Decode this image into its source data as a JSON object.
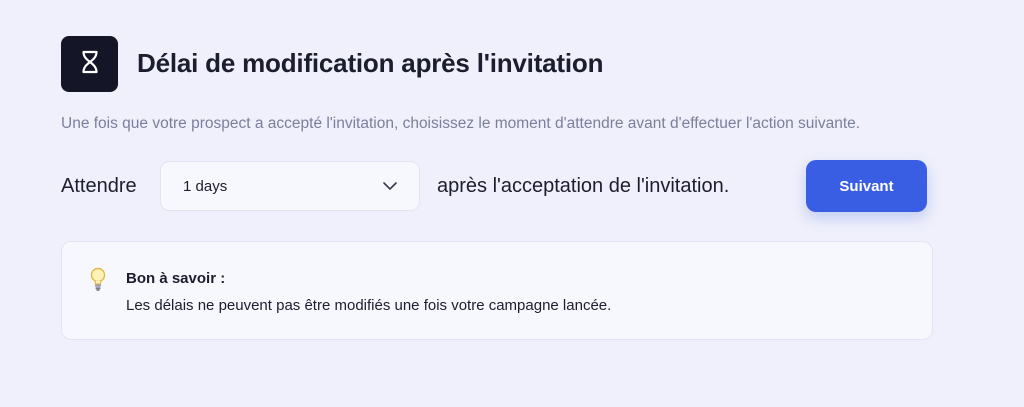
{
  "header": {
    "icon": "hourglass-icon",
    "title": "Délai de modification après l'invitation",
    "subtitle": "Une fois que votre prospect a accepté l'invitation, choisissez le moment d'attendre avant d'effectuer l'action suivante."
  },
  "delay_row": {
    "prefix_label": "Attendre",
    "select_value": "1 days",
    "select_icon": "chevron-down-icon",
    "suffix_label": "après l'acceptation de l'invitation.",
    "next_button_label": "Suivant"
  },
  "info": {
    "icon": "lightbulb-icon",
    "title": "Bon à savoir :",
    "text": "Les délais ne peuvent pas être modifiés une fois votre campagne lancée."
  },
  "colors": {
    "background": "#eff0fb",
    "icon_tile": "#141628",
    "primary_button": "#3a5ee3",
    "subtitle_text": "#7b7f9b",
    "card_background": "#f7f8fd"
  }
}
